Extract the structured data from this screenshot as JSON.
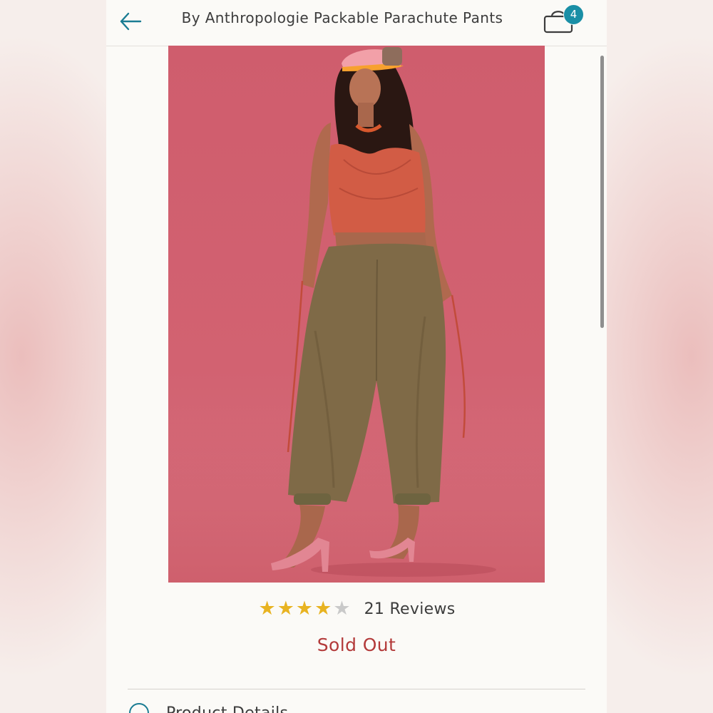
{
  "header": {
    "title": "By Anthropologie Packable Parachute Pants",
    "back_icon": "arrow-left-icon",
    "cart_icon": "shopping-bag-icon",
    "cart_count": "4"
  },
  "product": {
    "image_background": "#d26271"
  },
  "rating": {
    "value": 4,
    "max": 5,
    "star_filled_color": "#e8b321",
    "star_empty_color": "#c9c9c9",
    "reviews_label": "21 Reviews"
  },
  "status": {
    "sold_out_label": "Sold Out",
    "color": "#b33a3a"
  },
  "details": {
    "label": "Product Details",
    "icon": "circle-icon"
  },
  "colors": {
    "accent": "#1a8fa6"
  }
}
